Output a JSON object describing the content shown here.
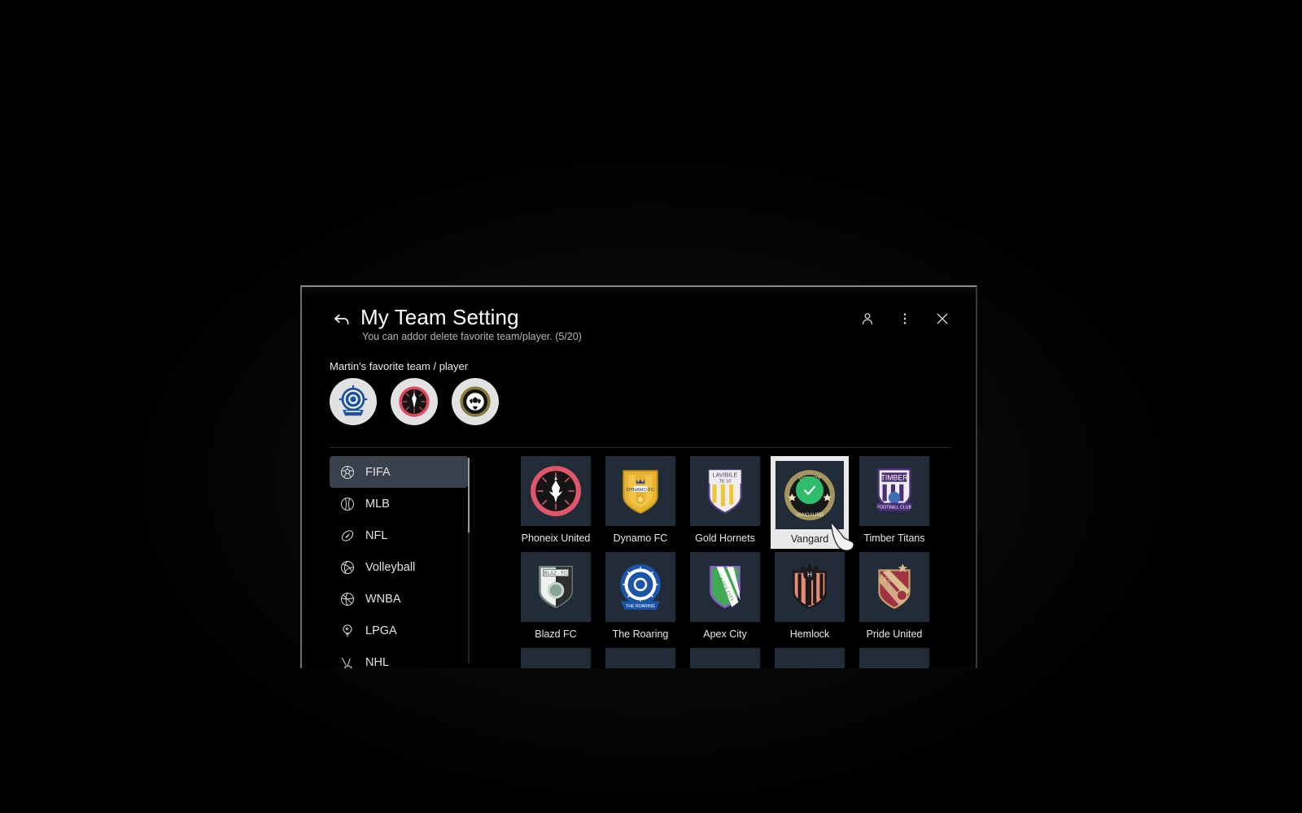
{
  "header": {
    "title": "My Team Setting",
    "subtitle": "You can addor delete favorite team/player. (5/20)",
    "back_icon": "back-arrow-icon",
    "profile_icon": "person-icon",
    "more_icon": "more-vertical-icon",
    "close_icon": "close-icon"
  },
  "favorites": {
    "label": "Martin's favorite team / player",
    "items": [
      {
        "name": "favorite-team-1",
        "style": "blue-gear-crest"
      },
      {
        "name": "favorite-team-2",
        "style": "red-eagle-crest"
      },
      {
        "name": "favorite-team-3",
        "style": "gold-soccer-crest"
      }
    ]
  },
  "sidebar": {
    "items": [
      {
        "label": "FIFA",
        "icon": "soccer-ball-icon",
        "active": true
      },
      {
        "label": "MLB",
        "icon": "baseball-icon",
        "active": false
      },
      {
        "label": "NFL",
        "icon": "football-icon",
        "active": false
      },
      {
        "label": "Volleyball",
        "icon": "volleyball-icon",
        "active": false
      },
      {
        "label": "WNBA",
        "icon": "basketball-icon",
        "active": false
      },
      {
        "label": "LPGA",
        "icon": "golf-ball-tee-icon",
        "active": false
      },
      {
        "label": "NHL",
        "icon": "hockey-icon",
        "active": false
      }
    ]
  },
  "teams": [
    {
      "label": "Phoneix United",
      "crest": "phoenix-united",
      "selected": false
    },
    {
      "label": "Dynamo FC",
      "crest": "dynamo-fc",
      "selected": false
    },
    {
      "label": "Gold Hornets",
      "crest": "gold-hornets",
      "selected": false
    },
    {
      "label": "Vangard",
      "crest": "vangard",
      "selected": true
    },
    {
      "label": "Timber Titans",
      "crest": "timber-titans",
      "selected": false
    },
    {
      "label": "Blazd FC",
      "crest": "blazd-fc",
      "selected": false
    },
    {
      "label": "The Roaring",
      "crest": "the-roaring",
      "selected": false
    },
    {
      "label": "Apex City",
      "crest": "apex-city",
      "selected": false
    },
    {
      "label": "Hemlock",
      "crest": "hemlock",
      "selected": false
    },
    {
      "label": "Pride United",
      "crest": "pride-united",
      "selected": false
    },
    {
      "label": "",
      "crest": "row3-a",
      "selected": false
    },
    {
      "label": "",
      "crest": "row3-b",
      "selected": false
    },
    {
      "label": "",
      "crest": "row3-c",
      "selected": false
    },
    {
      "label": "",
      "crest": "row3-d",
      "selected": false
    },
    {
      "label": "",
      "crest": "row3-e",
      "selected": false
    }
  ],
  "colors": {
    "selection_border": "#e9e9e9",
    "check_green": "#2fbd6b",
    "tile_bg": "#222b38",
    "active_nav": "#39424c"
  }
}
